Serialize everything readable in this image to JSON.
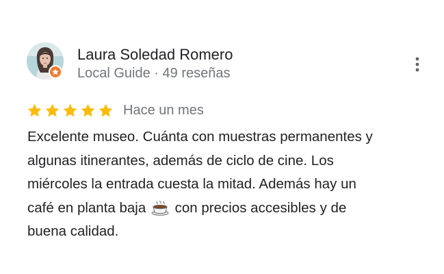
{
  "review": {
    "author": {
      "name": "Laura Soledad Romero",
      "meta": "Local Guide · 49 reseñas",
      "avatar_icon": "profile-photo",
      "badge_icon": "local-guide-star-icon",
      "badge_color": "#f07c2f"
    },
    "rating": {
      "stars": 5,
      "max_stars": 5,
      "star_color": "#fbbc04"
    },
    "date": "Hace un mes",
    "text_lines": {
      "l1": "Excelente museo. Cuánta con muestras permanentes y",
      "l2": "algunas itinerantes, además de ciclo de cine. Los",
      "l3": "miércoles la entrada cuesta la mitad.  Además hay un",
      "l4_before": "café en planta baja",
      "l4_after": "con precios accesibles y de",
      "l5": "buena calidad."
    },
    "inline_emoji": "coffee-cup-icon",
    "more_icon": "more-vertical-icon"
  }
}
